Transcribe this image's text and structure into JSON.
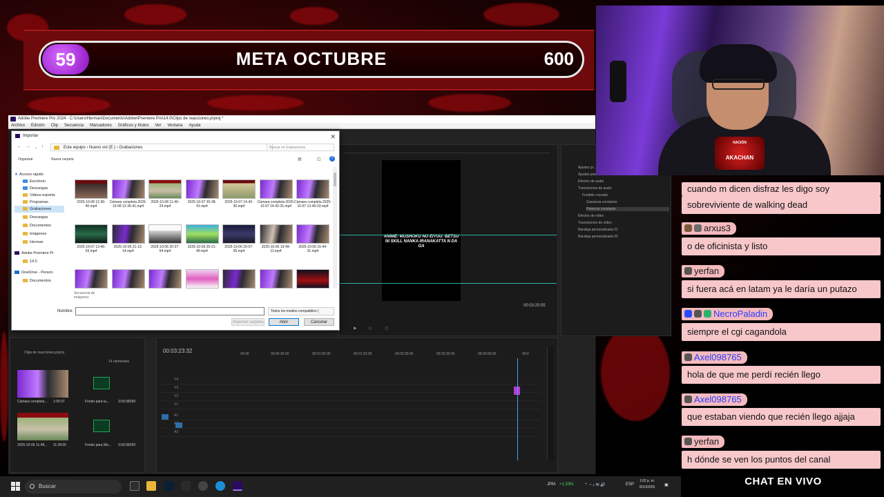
{
  "meta": {
    "current": "59",
    "title": "META OCTUBRE",
    "goal": "600"
  },
  "premiere": {
    "title": "Adobe Premiere Pro 2024 - C:\\Users\\Herman\\Documents\\Adobe\\Premiere Pro\\14.0\\Clips de reacciones.prproj *",
    "menu": [
      "Archivo",
      "Edición",
      "Clip",
      "Secuencia",
      "Marcadores",
      "Gráficos y títulos",
      "Ver",
      "Ventana",
      "Ayuda"
    ],
    "program_caption": "ANIME: MUSHOKU NO EIYUU: BETSU NI SKILL NANKA IRANAKATTA N DA GA",
    "program_timecode": "00:03:25:05",
    "effects": [
      "Ajustes pr...",
      "Ajustes preestablecidos de Lumetri",
      "Efectos de audio",
      "Transiciones de audio",
      "Fundido cruzado",
      "Ganancia constante",
      "Potencia constante",
      "Efectos de vídeo",
      "Transiciones de vídeo",
      "Bandeja personalizada 01",
      "Bandeja personalizada 02"
    ],
    "timeline": {
      "timecode": "00:03:23:32",
      "ticks": [
        "00:00",
        "00:00:30:00",
        "00:01:00:00",
        "00:01:30:00",
        "00:02:00:00",
        "00:02:30:00",
        "00:03:00:00",
        "00:0"
      ],
      "tracks": [
        "V4",
        "V3",
        "V2",
        "V1",
        "A1",
        "A2",
        "A3"
      ]
    },
    "project": {
      "name": "Clips de reacciones.prproj",
      "count": "14 elementos",
      "items": [
        {
          "name": "Cámara completa...",
          "duration": "1:09:37"
        },
        {
          "name": "Fondo para la...",
          "duration": "3:59:38399"
        },
        {
          "name": "2025-10-06 11:48...",
          "duration": "11:28:05"
        },
        {
          "name": "Fondo para Me...",
          "duration": "3:59:38399"
        }
      ]
    }
  },
  "import_dialog": {
    "title": "Importar",
    "breadcrumb": [
      "Este equipo",
      "Nuevo vol (E:)",
      "Grabaciones"
    ],
    "search_placeholder": "Buscar en Grabaciones",
    "organize": "Organizar",
    "new_folder": "Nueva carpeta",
    "tree": [
      "Acceso rápido",
      "Escritorio",
      "Descargas",
      "Videos exporta",
      "Programas",
      "Grabaciones",
      "Descargas",
      "Documentos",
      "Imágenes",
      "Herman",
      "Adobe Premiere Pr",
      "14.0",
      "OneDrive - Person",
      "Documentos"
    ],
    "files": [
      "2025-10-08 12-36-40.mp4",
      "Cámara completa 2025-10-08 12-36-41.mp4",
      "2025-10-08 11-40-24.mp4",
      "2025-10-07 20-38-41.mp4",
      "2025-10-07 14-42-30.mp4",
      "Cámara completa 2025-10-07 14-42-31.mp4",
      "Cámara completa 2025-10-07 13-46-03.mp4",
      "2025-10-07 13-46-03.mp4",
      "2025-10-06 21-13-14.mp4",
      "2025-10-06 20-37-54.mp4",
      "2025-10-06 20-21-49.mp4",
      "2025-10-06 20-07-05.mp4",
      "2025-10-06 19-49-11.mp4",
      "2025-10-06 16-44-31.mp4",
      "",
      "",
      "",
      "",
      "",
      "",
      ""
    ],
    "sequence_label": "Secuencia de imágenes",
    "name_label": "Nombre:",
    "name_value": "",
    "filetype": "Todos los medios compatibles (",
    "btn_import_folder": "Importar carpeta",
    "btn_open": "Abrir",
    "btn_cancel": "Cancelar"
  },
  "webcam": {
    "badge_top": "NACIÓN",
    "badge_name": "AKACHAN"
  },
  "chat": {
    "messages": [
      {
        "user": "",
        "text": "cuando m dicen disfraz les digo soy"
      },
      {
        "user": "",
        "text": "sobreviviente de walking dead"
      },
      {
        "user": "arxus3",
        "text": "o de oficinista y listo"
      },
      {
        "user": "yerfan",
        "text": "si fuera acá en latam ya le daría un putazo"
      },
      {
        "user": "NecroPaladin",
        "text": "siempre el cgi cagandola"
      },
      {
        "user": "Axel098765",
        "text": "hola de que me perdí recién llego"
      },
      {
        "user": "Axel098765",
        "text": "que estaban viendo que recién llego ajjaja"
      },
      {
        "user": "yerfan",
        "text": "h dónde se ven los puntos del canal"
      }
    ],
    "footer": "CHAT EN VIVO"
  },
  "taskbar": {
    "search": "Buscar",
    "ticker": "JPM",
    "ticker_change": "+1,33%",
    "lang": "ESP",
    "time": "1:02 p. m.",
    "date": "8/10/2025"
  },
  "colors": {
    "accent_purple": "#b44bff",
    "banner_red": "#6e0a0c",
    "chat_bg": "#f7c7ca",
    "guide": "#2bb3a0"
  }
}
